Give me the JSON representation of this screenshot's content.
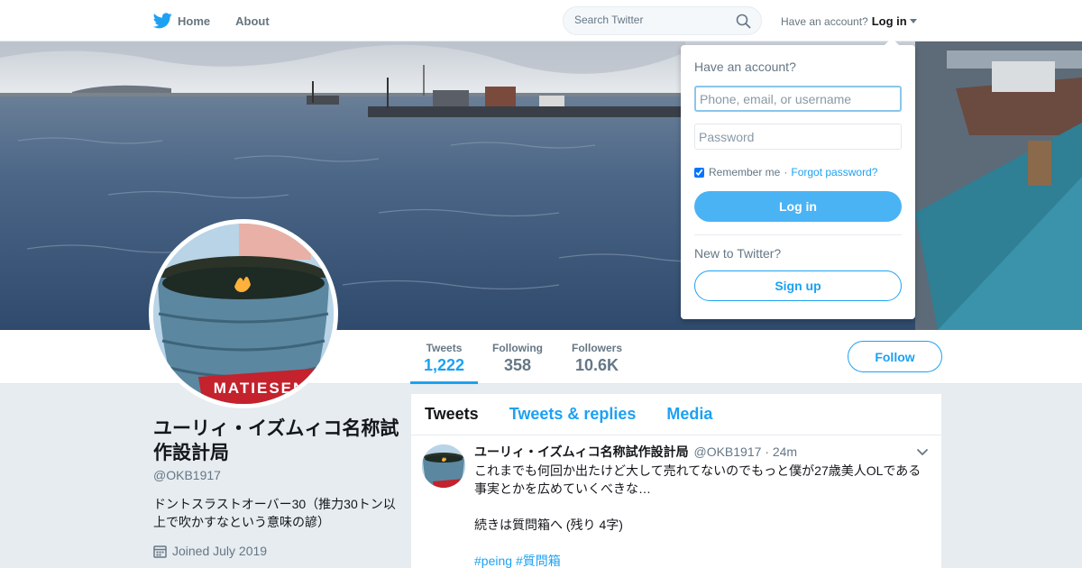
{
  "nav": {
    "brand_icon": "twitter-bird-icon",
    "home_label": "Home",
    "about_label": "About",
    "search_placeholder": "Search Twitter",
    "account_prompt": "Have an account?",
    "login_label": "Log in"
  },
  "login_dropdown": {
    "title": "Have an account?",
    "username_placeholder": "Phone, email, or username",
    "password_placeholder": "Password",
    "remember_label": "Remember me",
    "separator": "·",
    "forgot_label": "Forgot password?",
    "login_button": "Log in",
    "new_prompt": "New to Twitter?",
    "signup_button": "Sign up"
  },
  "stats": [
    {
      "label": "Tweets",
      "value": "1,222"
    },
    {
      "label": "Following",
      "value": "358"
    },
    {
      "label": "Followers",
      "value": "10.6K"
    }
  ],
  "follow_button": "Follow",
  "profile": {
    "name": "ユーリィ・イズムィコ名称試作設計局",
    "handle": "@OKB1917",
    "bio": "ドントスラストオーバー30（推力30トン以上で吹かすなという意味の諺）",
    "joined": "Joined July 2019",
    "avatar_text": "MATIESEN"
  },
  "timeline": {
    "tabs": [
      "Tweets",
      "Tweets & replies",
      "Media"
    ],
    "tweet": {
      "name": "ユーリィ・イズムィコ名称試作設計局",
      "meta": "@OKB1917 · 24m",
      "paragraph1": "これまでも何回か出たけど大して売れてないのでもっと僕が27歳美人OLである事実とかを広めていくべきな…",
      "paragraph2": "続きは質問箱へ (残り 4字)",
      "hashtag1": "#peing",
      "hashtag2": "#質問箱"
    }
  },
  "colors": {
    "accent": "#1da1f2",
    "login_button": "#4ab3f4",
    "page_background": "#e6ecf0"
  }
}
